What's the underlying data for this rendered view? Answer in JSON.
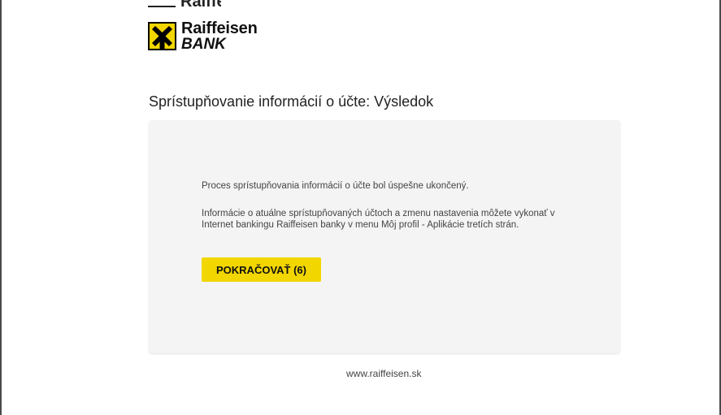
{
  "brand": {
    "name_line1": "Raiffeisen",
    "name_line2": "BANK",
    "ghost_text": "Raiffeisen",
    "accent_color": "#f2d600"
  },
  "page": {
    "title": "Sprístupňovanie informácií o účte: Výsledok"
  },
  "card": {
    "message_success": "Proces sprístupňovania informácií o účte bol úspešne ukončený.",
    "message_info": "Informácie o atuálne sprístupňovaných účtoch a zmenu nastavenia môžete vykonať v Internet bankingu Raiffeisen banky v menu Môj profil - Aplikácie tretích strán.",
    "continue_button_label": "POKRAČOVAŤ (6)"
  },
  "footer": {
    "link_text": "www.raiffeisen.sk"
  },
  "icons": {
    "logo_mark": "raiffeisen-gable-cross-icon"
  }
}
